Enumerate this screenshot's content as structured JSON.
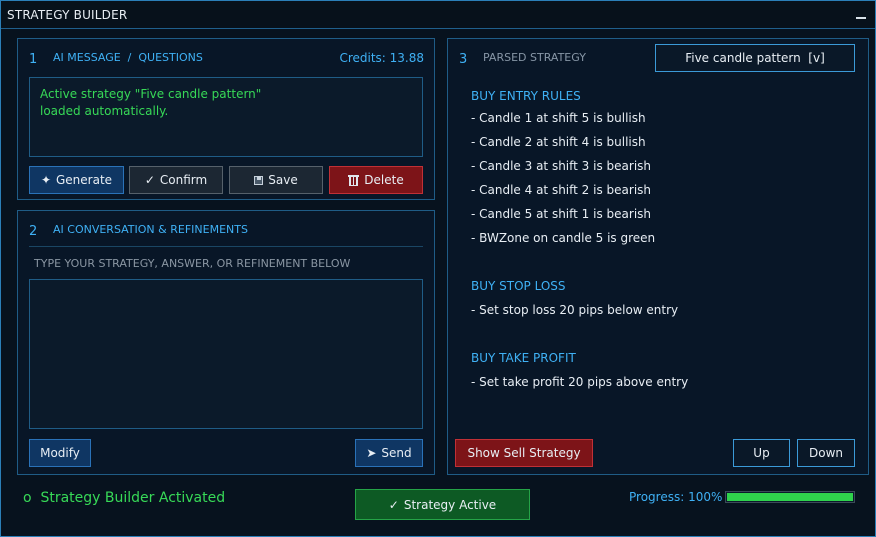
{
  "window": {
    "title": "STRATEGY BUILDER"
  },
  "panel1": {
    "number": "1",
    "title": "AI MESSAGE  /  QUESTIONS",
    "credits": "Credits: 13.88",
    "message": "Active strategy \"Five candle pattern\"\nloaded automatically.",
    "buttons": {
      "generate": "Generate",
      "confirm": "Confirm",
      "save": "Save",
      "delete": "Delete"
    }
  },
  "panel2": {
    "number": "2",
    "title": "AI CONVERSATION & REFINEMENTS",
    "hint": "TYPE YOUR STRATEGY, ANSWER, OR REFINEMENT BELOW",
    "input_value": "",
    "buttons": {
      "modify": "Modify",
      "send": "Send"
    }
  },
  "panel3": {
    "number": "3",
    "title": "PARSED STRATEGY",
    "selector": "Five candle pattern  [v]",
    "buy_entry": {
      "heading": "BUY ENTRY RULES",
      "rules": [
        "- Candle 1 at shift 5 is bullish",
        "- Candle 2 at shift 4 is bullish",
        "- Candle 3 at shift 3 is bearish",
        "- Candle 4 at shift 2 is bearish",
        "- Candle 5 at shift 1 is bearish",
        "- BWZone on candle 5 is green"
      ]
    },
    "buy_stop_loss": {
      "heading": "BUY STOP LOSS",
      "rules": [
        "- Set stop loss 20 pips below entry"
      ]
    },
    "buy_take_profit": {
      "heading": "BUY TAKE PROFIT",
      "rules": [
        "- Set take profit 20 pips above entry"
      ]
    },
    "buttons": {
      "show_sell": "Show Sell Strategy",
      "up": "Up",
      "down": "Down"
    }
  },
  "footer": {
    "status_text": "o  Strategy Builder Activated",
    "strategy_active": "Strategy Active",
    "progress_label": "Progress: 100%",
    "progress_value": 100
  },
  "colors": {
    "accent": "#3fb1f5",
    "success": "#37d957",
    "danger": "#7d1418",
    "background": "#07121e"
  }
}
